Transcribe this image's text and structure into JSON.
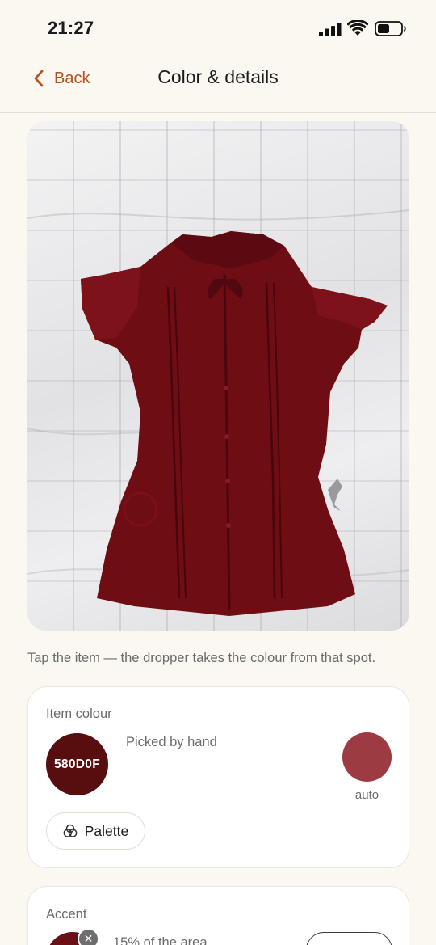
{
  "status_bar": {
    "time": "21:27",
    "icons": [
      "signal-icon",
      "wifi-icon",
      "battery-icon"
    ]
  },
  "nav": {
    "back_label": "Back",
    "title": "Color & details",
    "back_icon": "chevron-left-icon"
  },
  "photo": {
    "subject": "red-blouse-photo"
  },
  "hint": "Tap the item — the dropper takes the colour from that spot.",
  "item_colour": {
    "label": "Item colour",
    "hex_label": "580D0F",
    "hex_color": "#580d0f",
    "picked_label": "Picked by hand",
    "auto_color": "#9c3c42",
    "auto_label": "auto",
    "palette_label": "Palette",
    "palette_icon": "palette-circles-icon"
  },
  "accent": {
    "label": "Accent",
    "color": "#6a1016",
    "area_label": "15% of the area",
    "remove_icon": "close-icon"
  },
  "colors": {
    "accent_link": "#b5501f",
    "background": "#fbf7f1"
  }
}
